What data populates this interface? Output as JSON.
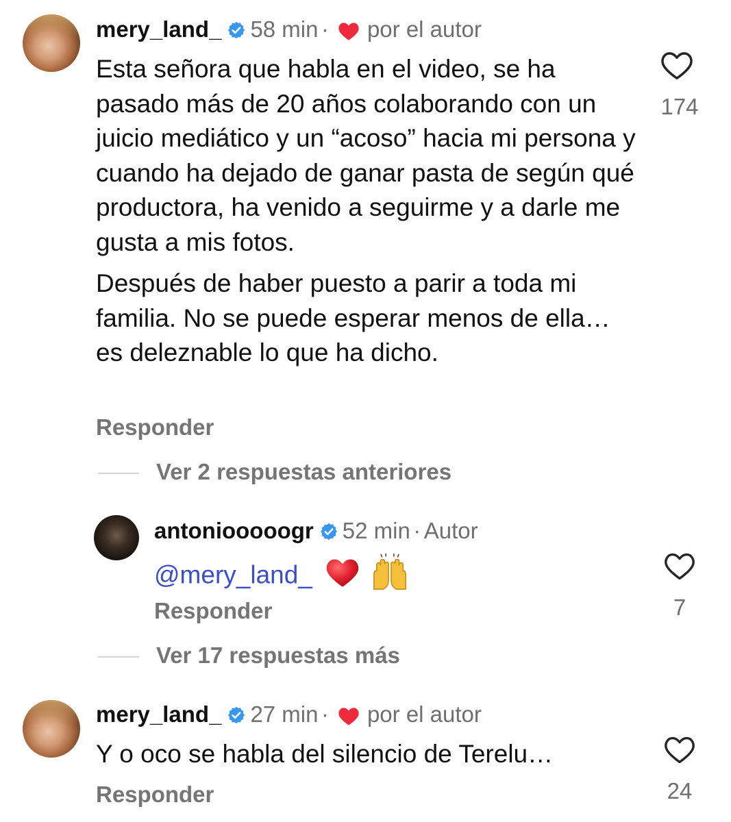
{
  "comments": [
    {
      "username": "mery_land_",
      "time": "58 min",
      "separator": "·",
      "liked_by_author": "por el autor",
      "paragraphs": [
        "Esta señora que habla en el video, se ha pasado más de 20 años colaborando con un juicio mediático y un “acoso” hacia mi persona y cuando ha dejado de ganar pasta de según qué productora, ha venido a seguirme y a darle me gusta a mis fotos.",
        "Después de haber puesto a parir a toda mi familia. No se puede esperar menos de ella… es deleznable lo que ha dicho."
      ],
      "reply_label": "Responder",
      "likes": "174",
      "icons": {
        "verified": "verified-badge-icon",
        "heart": "heart-outline-icon",
        "liked": "red-heart-icon"
      }
    },
    {
      "username": "antoniooooogr",
      "time": "52 min",
      "separator": "·",
      "author_badge": "Autor",
      "mention": "@mery_land_",
      "emojis": [
        "red-heart-emoji",
        "raising-hands-emoji"
      ],
      "reply_label": "Responder",
      "likes": "7"
    },
    {
      "username": "mery_land_",
      "time": "27 min",
      "separator": "·",
      "liked_by_author": "por el autor",
      "text": "Y o oco se habla del silencio de Terelu…",
      "reply_label": "Responder",
      "likes": "24"
    }
  ],
  "threads": {
    "previous_replies": "Ver 2 respuestas anteriores",
    "more_replies": "Ver 17 respuestas más"
  },
  "colors": {
    "verified_blue": "#3897f0",
    "heart_red": "#ed2b3d",
    "mention_blue": "#3a4ec9",
    "secondary_text": "#6f6f6f"
  }
}
